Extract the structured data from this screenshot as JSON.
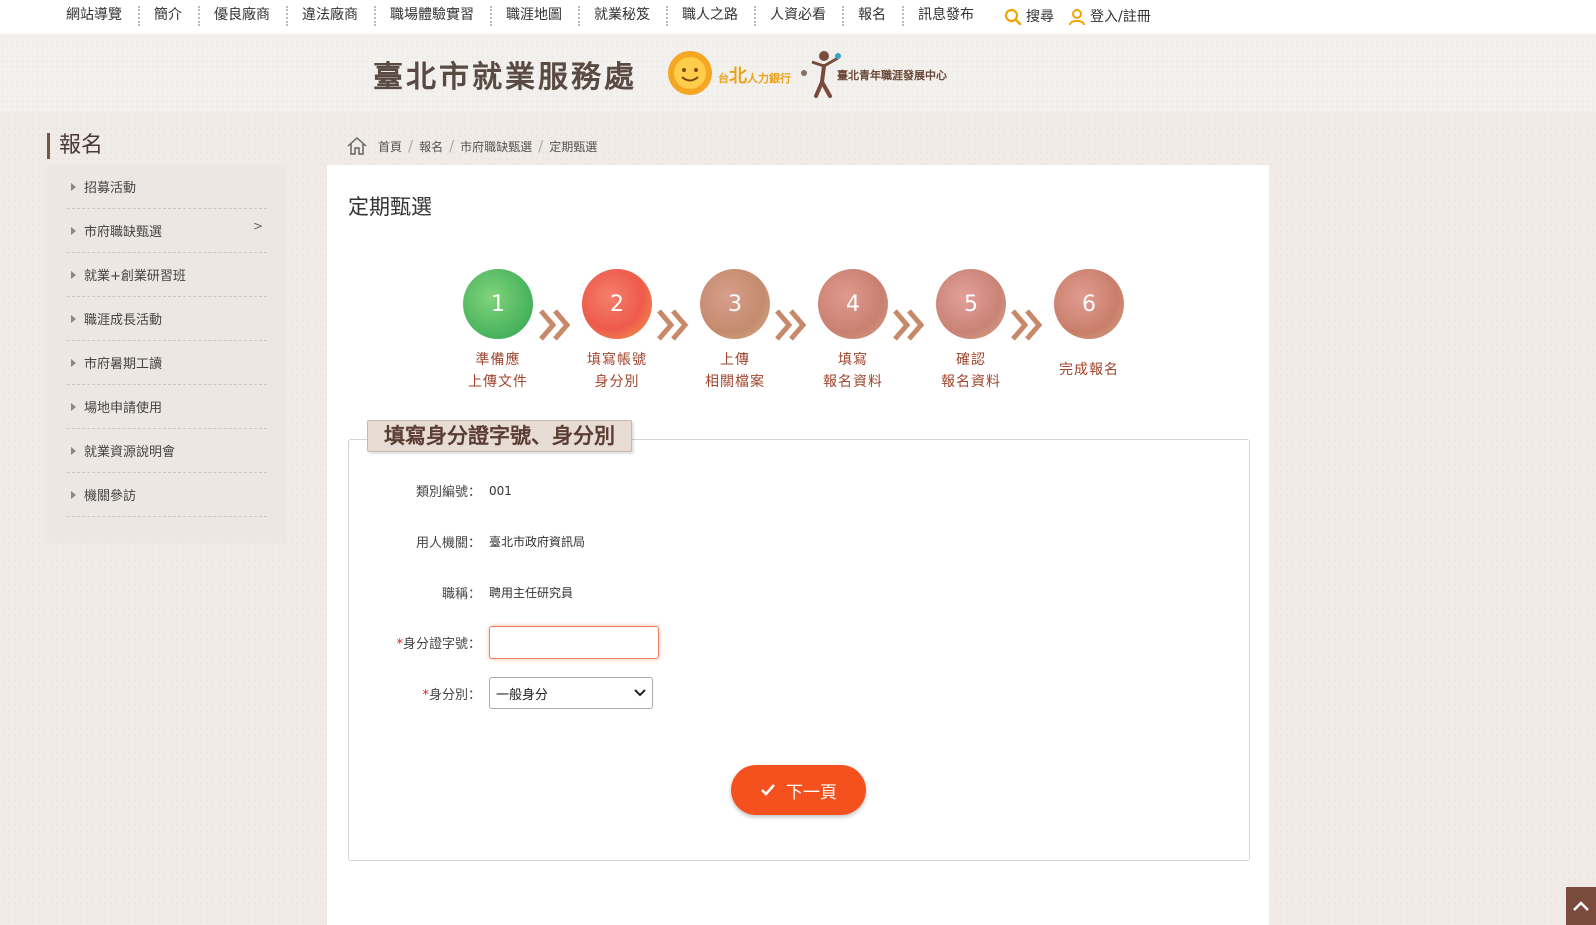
{
  "topnav": {
    "items": [
      "網站導覽",
      "簡介",
      "優良廠商",
      "違法廠商",
      "職場體驗實習",
      "職涯地圖",
      "就業秘笈",
      "職人之路",
      "人資必看",
      "報名",
      "訊息發布"
    ],
    "search_label": "搜尋",
    "login_label": "登入/註冊"
  },
  "header": {
    "title": "臺北市就業服務處",
    "bank_logo_small": "台",
    "bank_logo_big": "北",
    "bank_logo_text": "人力銀行",
    "youth_logo_text": "臺北青年職涯發展中心"
  },
  "sidebar": {
    "title": "報名",
    "items": [
      "招募活動",
      "市府職缺甄選",
      "就業+創業研習班",
      "職涯成長活動",
      "市府暑期工讀",
      "場地申請使用",
      "就業資源說明會",
      "機關參訪"
    ],
    "expand_glyph": ">"
  },
  "breadcrumb": {
    "items": [
      "首頁",
      "報名",
      "市府職缺甄選",
      "定期甄選"
    ],
    "separator": "/"
  },
  "main": {
    "title": "定期甄選"
  },
  "steps": [
    {
      "number": "1",
      "line1": "準備應",
      "line2": "上傳文件",
      "color": "#3cb55a"
    },
    {
      "number": "2",
      "line1": "填寫帳號",
      "line2": "身分別",
      "color": "#f06a4a"
    },
    {
      "number": "3",
      "line1": "上傳",
      "line2": "相關檔案",
      "color": "#c98b74"
    },
    {
      "number": "4",
      "line1": "填寫",
      "line2": "報名資料",
      "color": "#c9806e"
    },
    {
      "number": "5",
      "line1": "確認",
      "line2": "報名資料",
      "color": "#c98376"
    },
    {
      "number": "6",
      "line1": "完成報名",
      "line2": "",
      "color": "#c97e6a"
    }
  ],
  "form": {
    "legend": "填寫身分證字號、身分別",
    "category_label": "類別編號：",
    "category_value": "001",
    "agency_label": "用人機關：",
    "agency_value": "臺北市政府資訊局",
    "position_label": "職稱：",
    "position_value": "聘用主任研究員",
    "required_mark": "*",
    "id_label": "身分證字號：",
    "id_value": "",
    "identity_label": "身分別：",
    "identity_value": "一般身分",
    "next_button": "下一頁"
  },
  "colors": {
    "accent": "#f4511e",
    "brown": "#7a4a3c",
    "step_text": "#a0452e"
  }
}
